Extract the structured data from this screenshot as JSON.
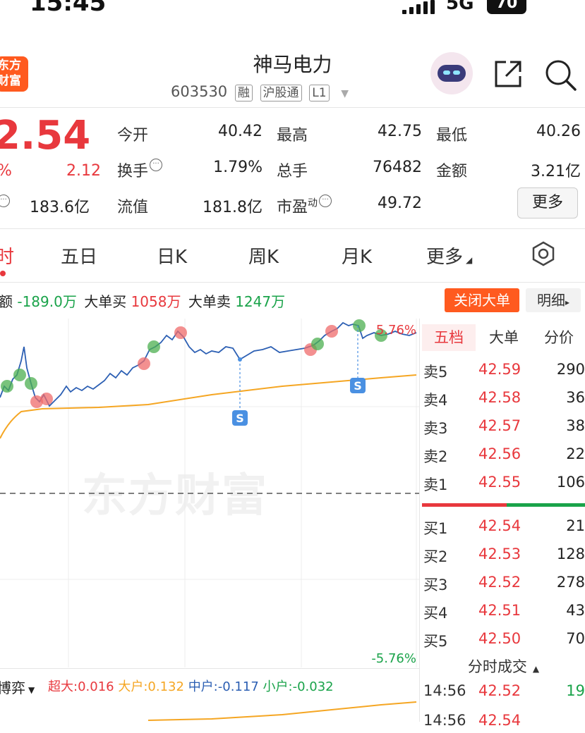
{
  "status_bar": {
    "time": "15:45",
    "network": "5G",
    "battery": "70"
  },
  "header": {
    "logo_text": [
      "东方",
      "财富"
    ],
    "title": "神马电力",
    "code": "603530",
    "tags": [
      "融",
      "沪股通",
      "L1"
    ]
  },
  "quote": {
    "price": "2.54",
    "change_pct": "%",
    "change": "2.12",
    "row3_left_value": "183.6亿",
    "cells": [
      {
        "label": "今开",
        "value": "40.42",
        "color": "#222222"
      },
      {
        "label": "最高",
        "value": "42.75",
        "color": "#e8383d"
      },
      {
        "label": "最低",
        "value": "40.26",
        "color": "#1aa34a"
      },
      {
        "label": "换手",
        "value": "1.79%",
        "color": "#222222"
      },
      {
        "label": "总手",
        "value": "76482",
        "color": "#222222"
      },
      {
        "label": "金额",
        "value": "3.21亿",
        "color": "#222222"
      },
      {
        "label": "流值",
        "value": "181.8亿",
        "color": "#222222"
      },
      {
        "label": "市盈",
        "sup": "动",
        "value": "49.72",
        "color": "#222222"
      }
    ],
    "more_label": "更多"
  },
  "tabs": [
    "时",
    "五日",
    "日K",
    "周K",
    "月K",
    "更多"
  ],
  "flow": {
    "net_label": "额",
    "net_value": "-189.0万",
    "big_buy_label": "大单买",
    "big_buy_value": "1058万",
    "big_sell_label": "大单卖",
    "big_sell_value": "1247万",
    "close_btn": "关闭大单",
    "detail_btn": "明细"
  },
  "chart_data": {
    "type": "line",
    "top_pct_label": "5.76%",
    "bottom_pct_label": "-5.76%",
    "ylim_pct": [
      -5.76,
      5.76
    ],
    "watermark": "东方财富",
    "series": [
      {
        "role": "price",
        "color": "#2c5fb3"
      },
      {
        "role": "average",
        "color": "#f5a623"
      }
    ],
    "sell_marker_label": "S"
  },
  "order_book": {
    "tabs": [
      "五档",
      "大单",
      "分价"
    ],
    "sells": [
      {
        "label": "卖5",
        "price": "42.59",
        "vol": "290"
      },
      {
        "label": "卖4",
        "price": "42.58",
        "vol": "36"
      },
      {
        "label": "卖3",
        "price": "42.57",
        "vol": "38"
      },
      {
        "label": "卖2",
        "price": "42.56",
        "vol": "22"
      },
      {
        "label": "卖1",
        "price": "42.55",
        "vol": "106"
      }
    ],
    "buys": [
      {
        "label": "买1",
        "price": "42.54",
        "vol": "21"
      },
      {
        "label": "买2",
        "price": "42.53",
        "vol": "128"
      },
      {
        "label": "买3",
        "price": "42.52",
        "vol": "278"
      },
      {
        "label": "买4",
        "price": "42.51",
        "vol": "43"
      },
      {
        "label": "买5",
        "price": "42.50",
        "vol": "70"
      }
    ]
  },
  "trades": {
    "title": "分时成交",
    "rows": [
      {
        "time": "14:56",
        "price": "42.52",
        "vol": "19"
      },
      {
        "time": "14:56",
        "price": "42.54",
        "vol": ""
      }
    ]
  },
  "bottom": {
    "label": "博弈",
    "stats": [
      {
        "text": "超大:0.016",
        "color": "#e8383d"
      },
      {
        "text": "大户:0.132",
        "color": "#f5a623"
      },
      {
        "text": "中户:-0.117",
        "color": "#2c5fb3"
      },
      {
        "text": "小户:-0.032",
        "color": "#1aa34a"
      }
    ]
  }
}
